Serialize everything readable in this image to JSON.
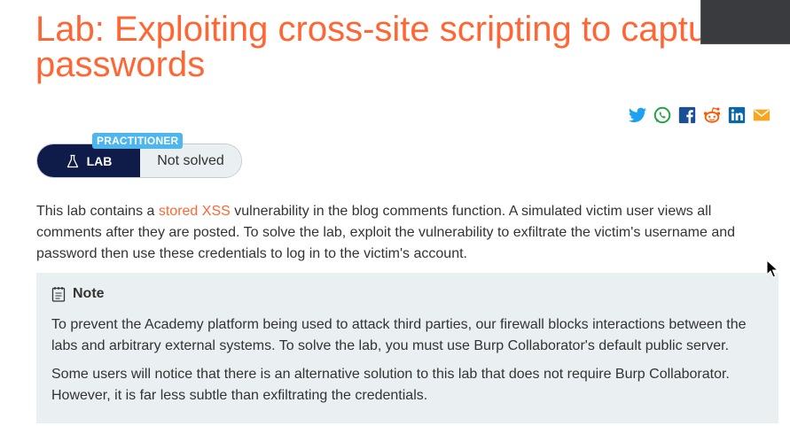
{
  "lab": {
    "title": "Lab: Exploiting cross-site scripting to capture passwords",
    "level": "PRACTITIONER",
    "badge_label": "LAB",
    "status": "Not solved"
  },
  "share": [
    "twitter-icon",
    "whatsapp-icon",
    "facebook-icon",
    "reddit-icon",
    "linkedin-icon",
    "email-icon"
  ],
  "description": {
    "before_link": "This lab contains a ",
    "link": "stored XSS",
    "after_link": " vulnerability in the blog comments function. A simulated victim user views all comments after they are posted. To solve the lab, exploit the vulnerability to exfiltrate the victim's username and password then use these credentials to log in to the victim's account."
  },
  "note": {
    "title": "Note",
    "paragraph1": "To prevent the Academy platform being used to attack third parties, our firewall blocks interactions between the labs and arbitrary external systems. To solve the lab, you must use Burp Collaborator's default public server.",
    "paragraph2": "Some users will notice that there is an alternative solution to this lab that does not require Burp Collaborator. However, it is far less subtle than exfiltrating the credentials."
  },
  "colors": {
    "accent": "#ff6633",
    "navy": "#0f1c4a",
    "level_blue": "#4eb6ef",
    "note_bg": "#eaeff1"
  }
}
